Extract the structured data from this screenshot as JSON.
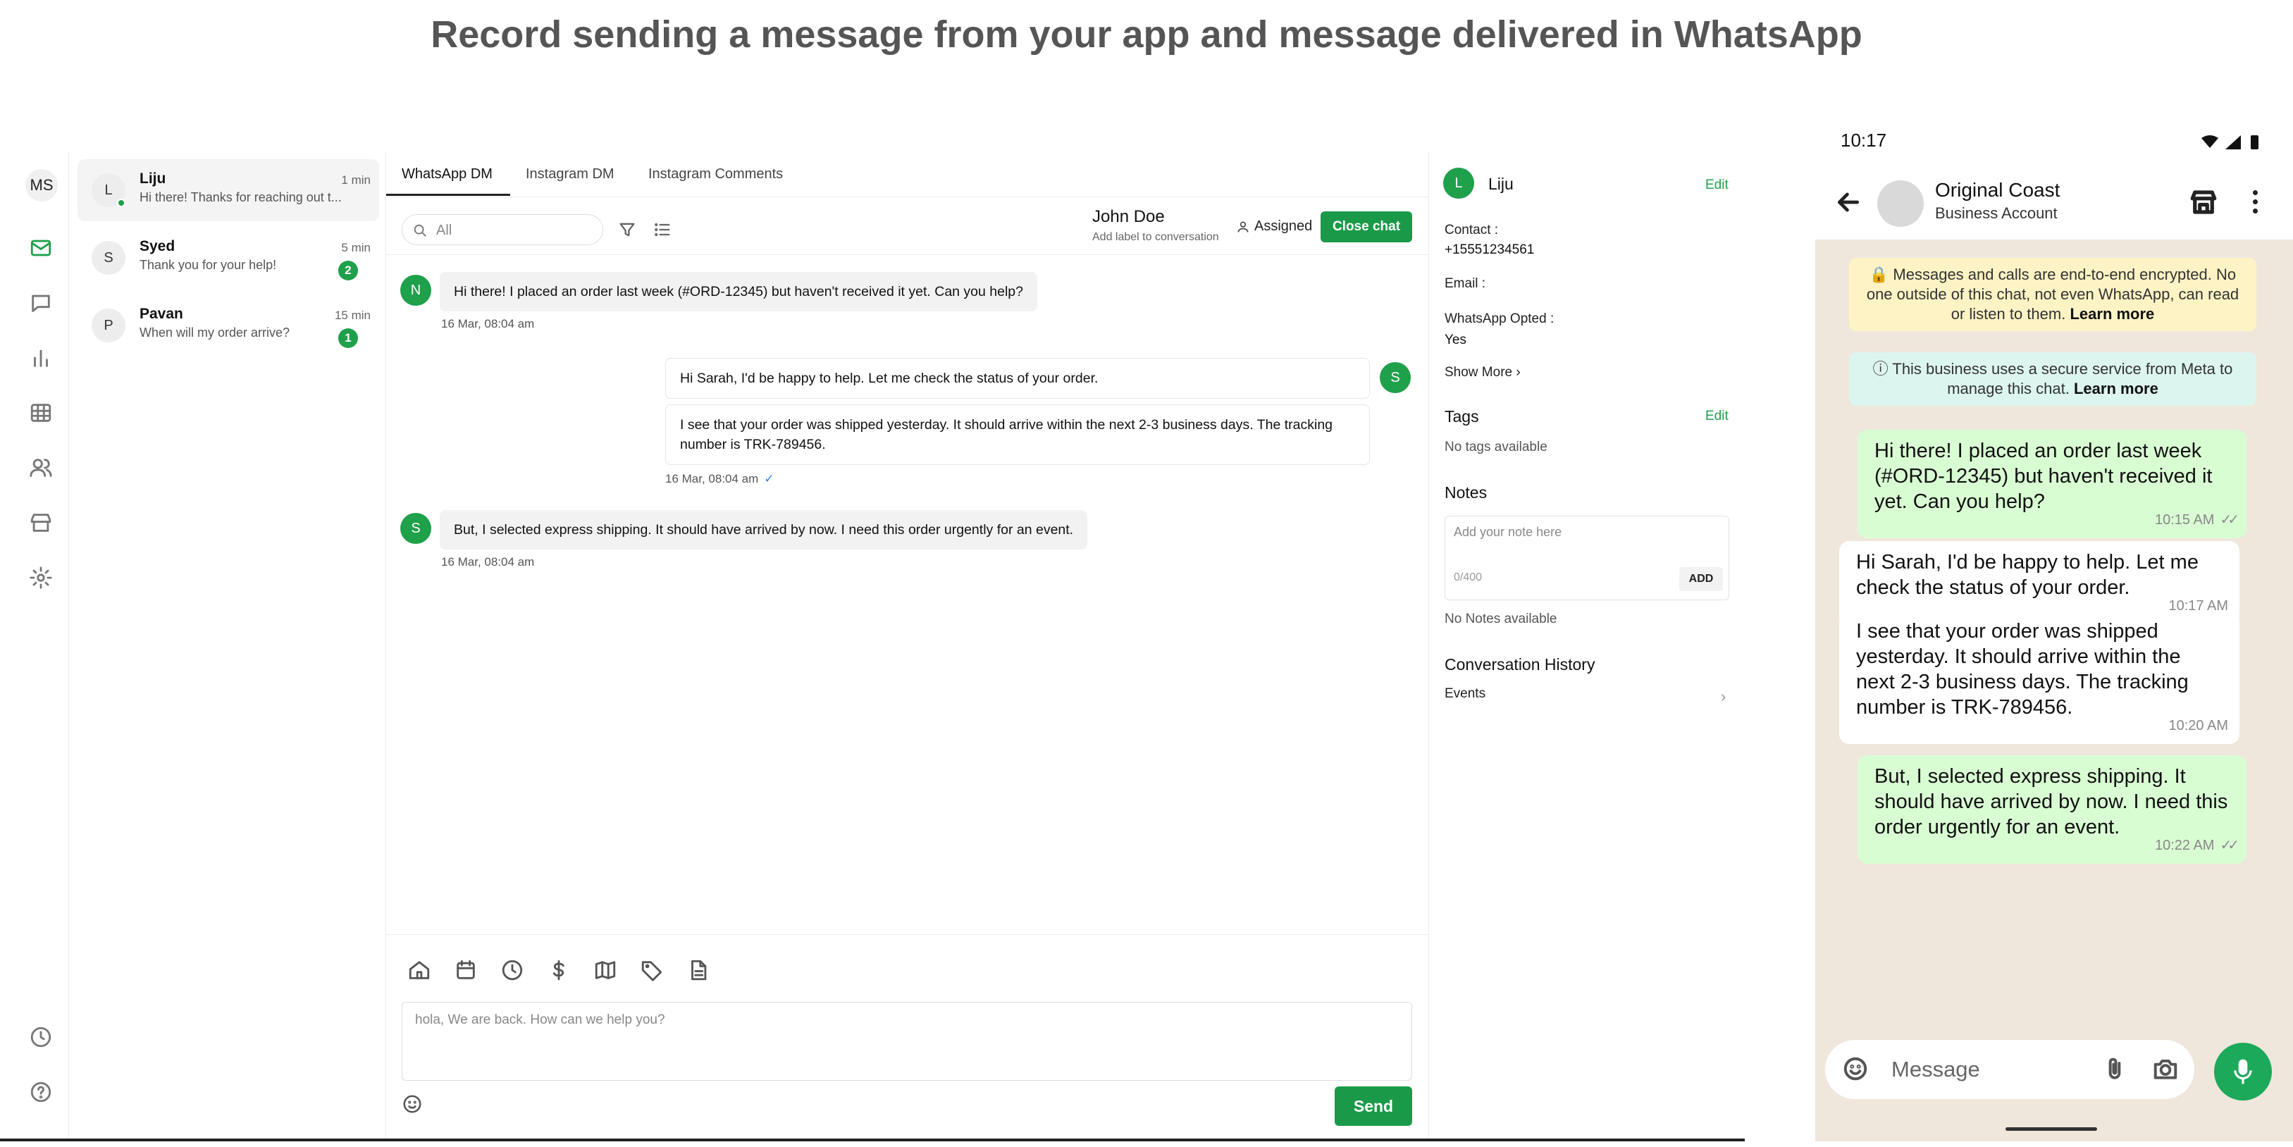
{
  "page_title": "Record sending a message from your app and message delivered in WhatsApp",
  "app": {
    "user_initials": "MS",
    "nav_icons": [
      "mail-icon",
      "chat-icon",
      "bar-chart-icon",
      "table-icon",
      "users-icon",
      "store-icon",
      "settings-icon",
      "clock-icon",
      "help-icon"
    ],
    "conversations": [
      {
        "initial": "L",
        "name": "Liju",
        "preview": "Hi there! Thanks for reaching out t...",
        "time": "1 min",
        "badge": "",
        "online": true
      },
      {
        "initial": "S",
        "name": "Syed",
        "preview": "Thank you for your help!",
        "time": "5 min",
        "badge": "2"
      },
      {
        "initial": "P",
        "name": "Pavan",
        "preview": "When will my order arrive?",
        "time": "15 min",
        "badge": "1"
      }
    ],
    "tabs": [
      "WhatsApp DM",
      "Instagram DM",
      "Instagram Comments"
    ],
    "active_tab": "WhatsApp DM",
    "search": {
      "placeholder": "All"
    },
    "contact": {
      "name": "John Doe",
      "label_hint": "Add label to conversation"
    },
    "assigned_label": "Assigned",
    "close_chat_label": "Close chat",
    "messages": [
      {
        "avatar": "N",
        "text": "Hi there! I placed an order last week (#ORD-12345) but haven't received it yet. Can you help?",
        "time": "16 Mar, 08:04 am"
      },
      {
        "avatar": "S",
        "text_1": "Hi Sarah, I'd be happy to help. Let me check the status of your order.",
        "text_2": "I see that your order was shipped yesterday. It should arrive within the next 2-3 business days. The tracking number is TRK-789456.",
        "time": "16 Mar, 08:04 am",
        "tick": "✓"
      },
      {
        "avatar": "S",
        "text": "But, I selected express shipping. It should have arrived by now. I need this order urgently for an event.",
        "time": "16 Mar, 08:04 am"
      }
    ],
    "composer": {
      "icons": [
        "home-icon",
        "calendar-icon",
        "clock-icon",
        "dollar-icon",
        "map-icon",
        "tag-icon",
        "document-icon"
      ],
      "placeholder": "hola, We are back. How can we help you?",
      "send_label": "Send"
    },
    "details": {
      "initial": "L",
      "name": "Liju",
      "edit_label": "Edit",
      "contact_label": "Contact :",
      "contact_value": "+15551234561",
      "email_label": "Email :",
      "opted_label": "WhatsApp Opted :",
      "opted_value": "Yes",
      "show_more": "Show More",
      "tags_heading": "Tags",
      "tags_empty": "No tags available",
      "notes_heading": "Notes",
      "notes_placeholder": "Add your note here",
      "notes_count": "0/400",
      "notes_add": "ADD",
      "notes_empty": "No Notes available",
      "history_heading": "Conversation History",
      "events_label": "Events"
    }
  },
  "phone": {
    "time": "10:17",
    "contact_name": "Original Coast",
    "contact_sub": "Business Account",
    "encryption_notice": "Messages and calls are end-to-end encrypted. No one outside of this chat, not even WhatsApp, can read or listen to them.",
    "meta_notice": "This business uses a secure service from Meta to manage this chat.",
    "learn_more": "Learn more",
    "messages": [
      {
        "dir": "out",
        "text": "Hi there! I placed an order last week (#ORD-12345) but haven't received it yet. Can you help?",
        "time": "10:15 AM"
      },
      {
        "dir": "in",
        "text": "Hi Sarah, I'd be happy to help. Let me check the status of your order.",
        "time": "10:17 AM"
      },
      {
        "dir": "in",
        "text": "I see that your order was shipped yesterday. It should arrive within the next 2-3 business days. The tracking number is TRK-789456.",
        "time": "10:20 AM"
      },
      {
        "dir": "out",
        "text": "But, I selected express shipping. It should have arrived by now. I need this order urgently for an event.",
        "time": "10:22 AM"
      }
    ],
    "input_placeholder": "Message"
  },
  "colors": {
    "brand_green": "#1a9a49",
    "wa_out_bubble": "#d9fdd3",
    "wa_notice_yellow": "#fdf3c4",
    "wa_notice_green": "#dcf5ef"
  }
}
